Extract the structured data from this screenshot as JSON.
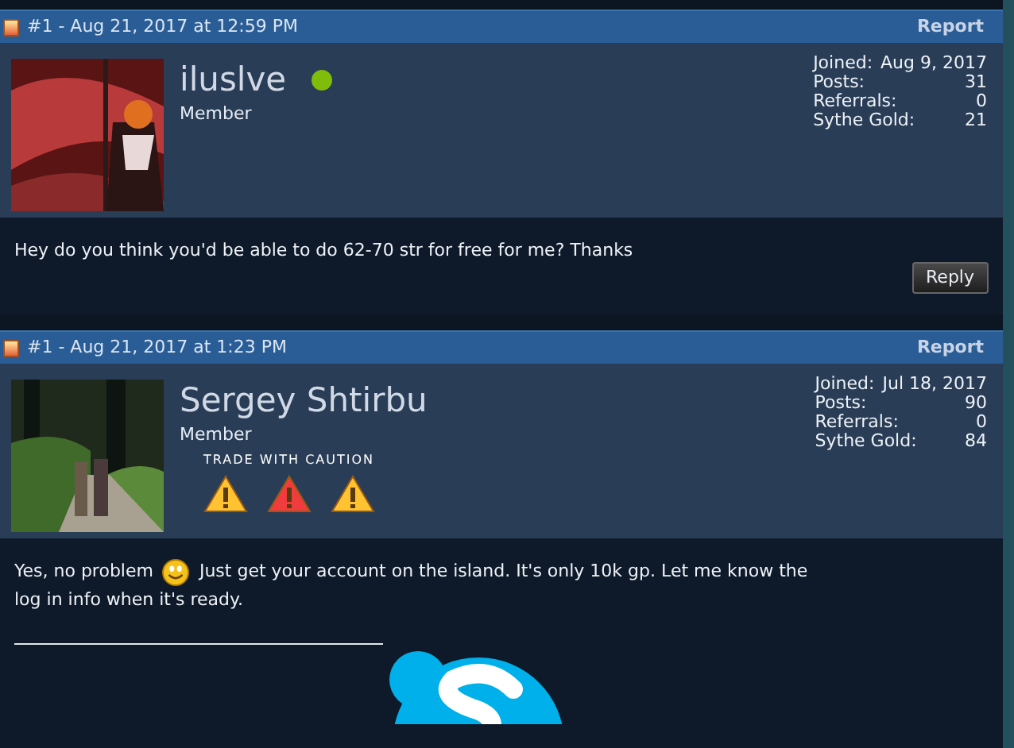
{
  "posts": [
    {
      "header": "#1 - Aug 21, 2017 at 12:59 PM",
      "report": "Report",
      "username": "iluslve",
      "online": true,
      "rank": "Member",
      "avatar": {
        "kind": "picture"
      },
      "stats": [
        {
          "label": "Joined:",
          "value": "Aug 9, 2017"
        },
        {
          "label": "Posts:",
          "value": "31"
        },
        {
          "label": "Referrals:",
          "value": "0"
        },
        {
          "label": "Sythe Gold:",
          "value": "21"
        }
      ],
      "message": [
        [
          {
            "kind": "text",
            "text": "Hey do you think you'd be able to do 62-70 str for free for me? Thanks"
          }
        ]
      ],
      "reply": "Reply",
      "signature": false
    },
    {
      "header": "#1 - Aug 21, 2017 at 1:23 PM",
      "report": "Report",
      "username": "Sergey Shtirbu",
      "online": false,
      "rank": "Member",
      "avatar": {
        "kind": "picture"
      },
      "caution": {
        "label": "TRADE WITH CAUTION",
        "warnings": [
          {
            "color": "#ffc233"
          },
          {
            "color": "#f03c3c"
          },
          {
            "color": "#ffc233"
          }
        ]
      },
      "stats": [
        {
          "label": "Joined:",
          "value": "Jul 18, 2017"
        },
        {
          "label": "Posts:",
          "value": "90"
        },
        {
          "label": "Referrals:",
          "value": "0"
        },
        {
          "label": "Sythe Gold:",
          "value": "84"
        }
      ],
      "message": [
        [
          {
            "kind": "text",
            "text": "Yes, no problem"
          },
          {
            "kind": "smiley"
          },
          {
            "kind": "text",
            "text": "Just get your account on the island. It's only 10k gp. Let me know the"
          }
        ],
        [
          {
            "kind": "text",
            "text": "log in info when it's ready."
          }
        ]
      ],
      "signature": true
    }
  ]
}
